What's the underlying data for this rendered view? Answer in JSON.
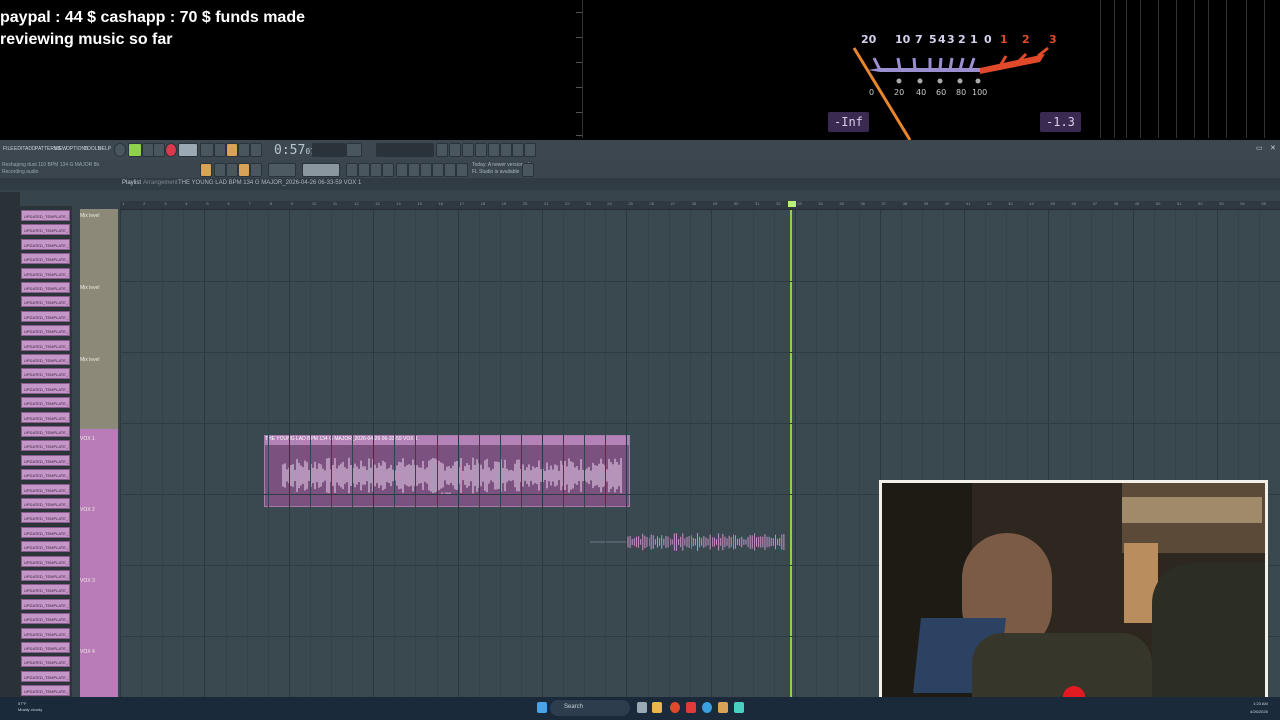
{
  "overlay": {
    "donation_line1": "paypal : 44 $  cashapp : 70 $ funds made",
    "donation_line2": "reviewing music so far",
    "vu_scale_top": [
      "20",
      "10",
      "7",
      "5",
      "4",
      "3",
      "2",
      "1",
      "0",
      "1",
      "2",
      "3"
    ],
    "vu_scale_bottom": [
      "0",
      "20",
      "40",
      "60",
      "80",
      "100"
    ],
    "vu_left_readout": "-Inf",
    "vu_right_readout": "-1.3",
    "colors": {
      "vu_needle": "#e8862d",
      "vu_red": "#e04a2a",
      "vu_purple": "#9b8fd0",
      "badge_bg": "#3a2a52"
    }
  },
  "daw": {
    "menu": [
      "FILE",
      "EDIT",
      "ADD",
      "PATTERNS",
      "VIEW",
      "OPTIONS",
      "TOOLS",
      "HELP"
    ],
    "song_time": "0:57",
    "song_time_sub": "071",
    "hint_line1": "Reshaping dust 110 BPM 134 G MAJOR 8b",
    "hint_line2": "Recording audio",
    "hint_right_line1": "Today: A newer version of",
    "hint_right_line2": "FL Studio is available",
    "playlist_label": "Playlist",
    "playlist_arrangement": "Arrangement",
    "playlist_title": "THE YOUNG LAD BPM 134  G MAJOR_2026-04-26 06-33-59 VOX 1",
    "timeline_numbers": [
      "1",
      "2",
      "3",
      "4",
      "5",
      "6",
      "7",
      "8",
      "9",
      "10",
      "11",
      "12",
      "13",
      "14",
      "15",
      "16",
      "17",
      "18",
      "19",
      "20",
      "21",
      "22",
      "23",
      "24",
      "25",
      "26",
      "27",
      "28",
      "29",
      "30",
      "31",
      "32",
      "33",
      "34",
      "35",
      "36",
      "37",
      "38",
      "39",
      "40",
      "41",
      "42",
      "43",
      "44",
      "45",
      "46",
      "47",
      "48",
      "49",
      "50",
      "51",
      "52",
      "53",
      "54",
      "55"
    ],
    "picker_items_label": "UPDATED_TEMPLATE_1_15",
    "picker_count": 34,
    "track_headers": [
      {
        "label": "Mix level"
      },
      {
        "label": "Mix level"
      },
      {
        "label": "Mix level"
      },
      {
        "label": "VOX 1"
      },
      {
        "label": "VOX 2"
      },
      {
        "label": "VOX 3"
      },
      {
        "label": "VOX 4"
      }
    ],
    "clip1_name": "THE YOUNG LAD BPM 134  G MAJOR_2026-04-26 06-33-59 VOX 1",
    "clip1_sub": "5.388",
    "colors": {
      "bg": "#38444c",
      "clip": "#7b517f",
      "clip_header": "#b582b8",
      "playhead": "#8fd14f",
      "track_pink": "#b97cb9"
    }
  },
  "taskbar": {
    "weather_temp": "57°F",
    "weather_desc": "Mostly cloudy",
    "search_placeholder": "Search",
    "time": "1:23 AM",
    "date": "4/26/2026"
  }
}
